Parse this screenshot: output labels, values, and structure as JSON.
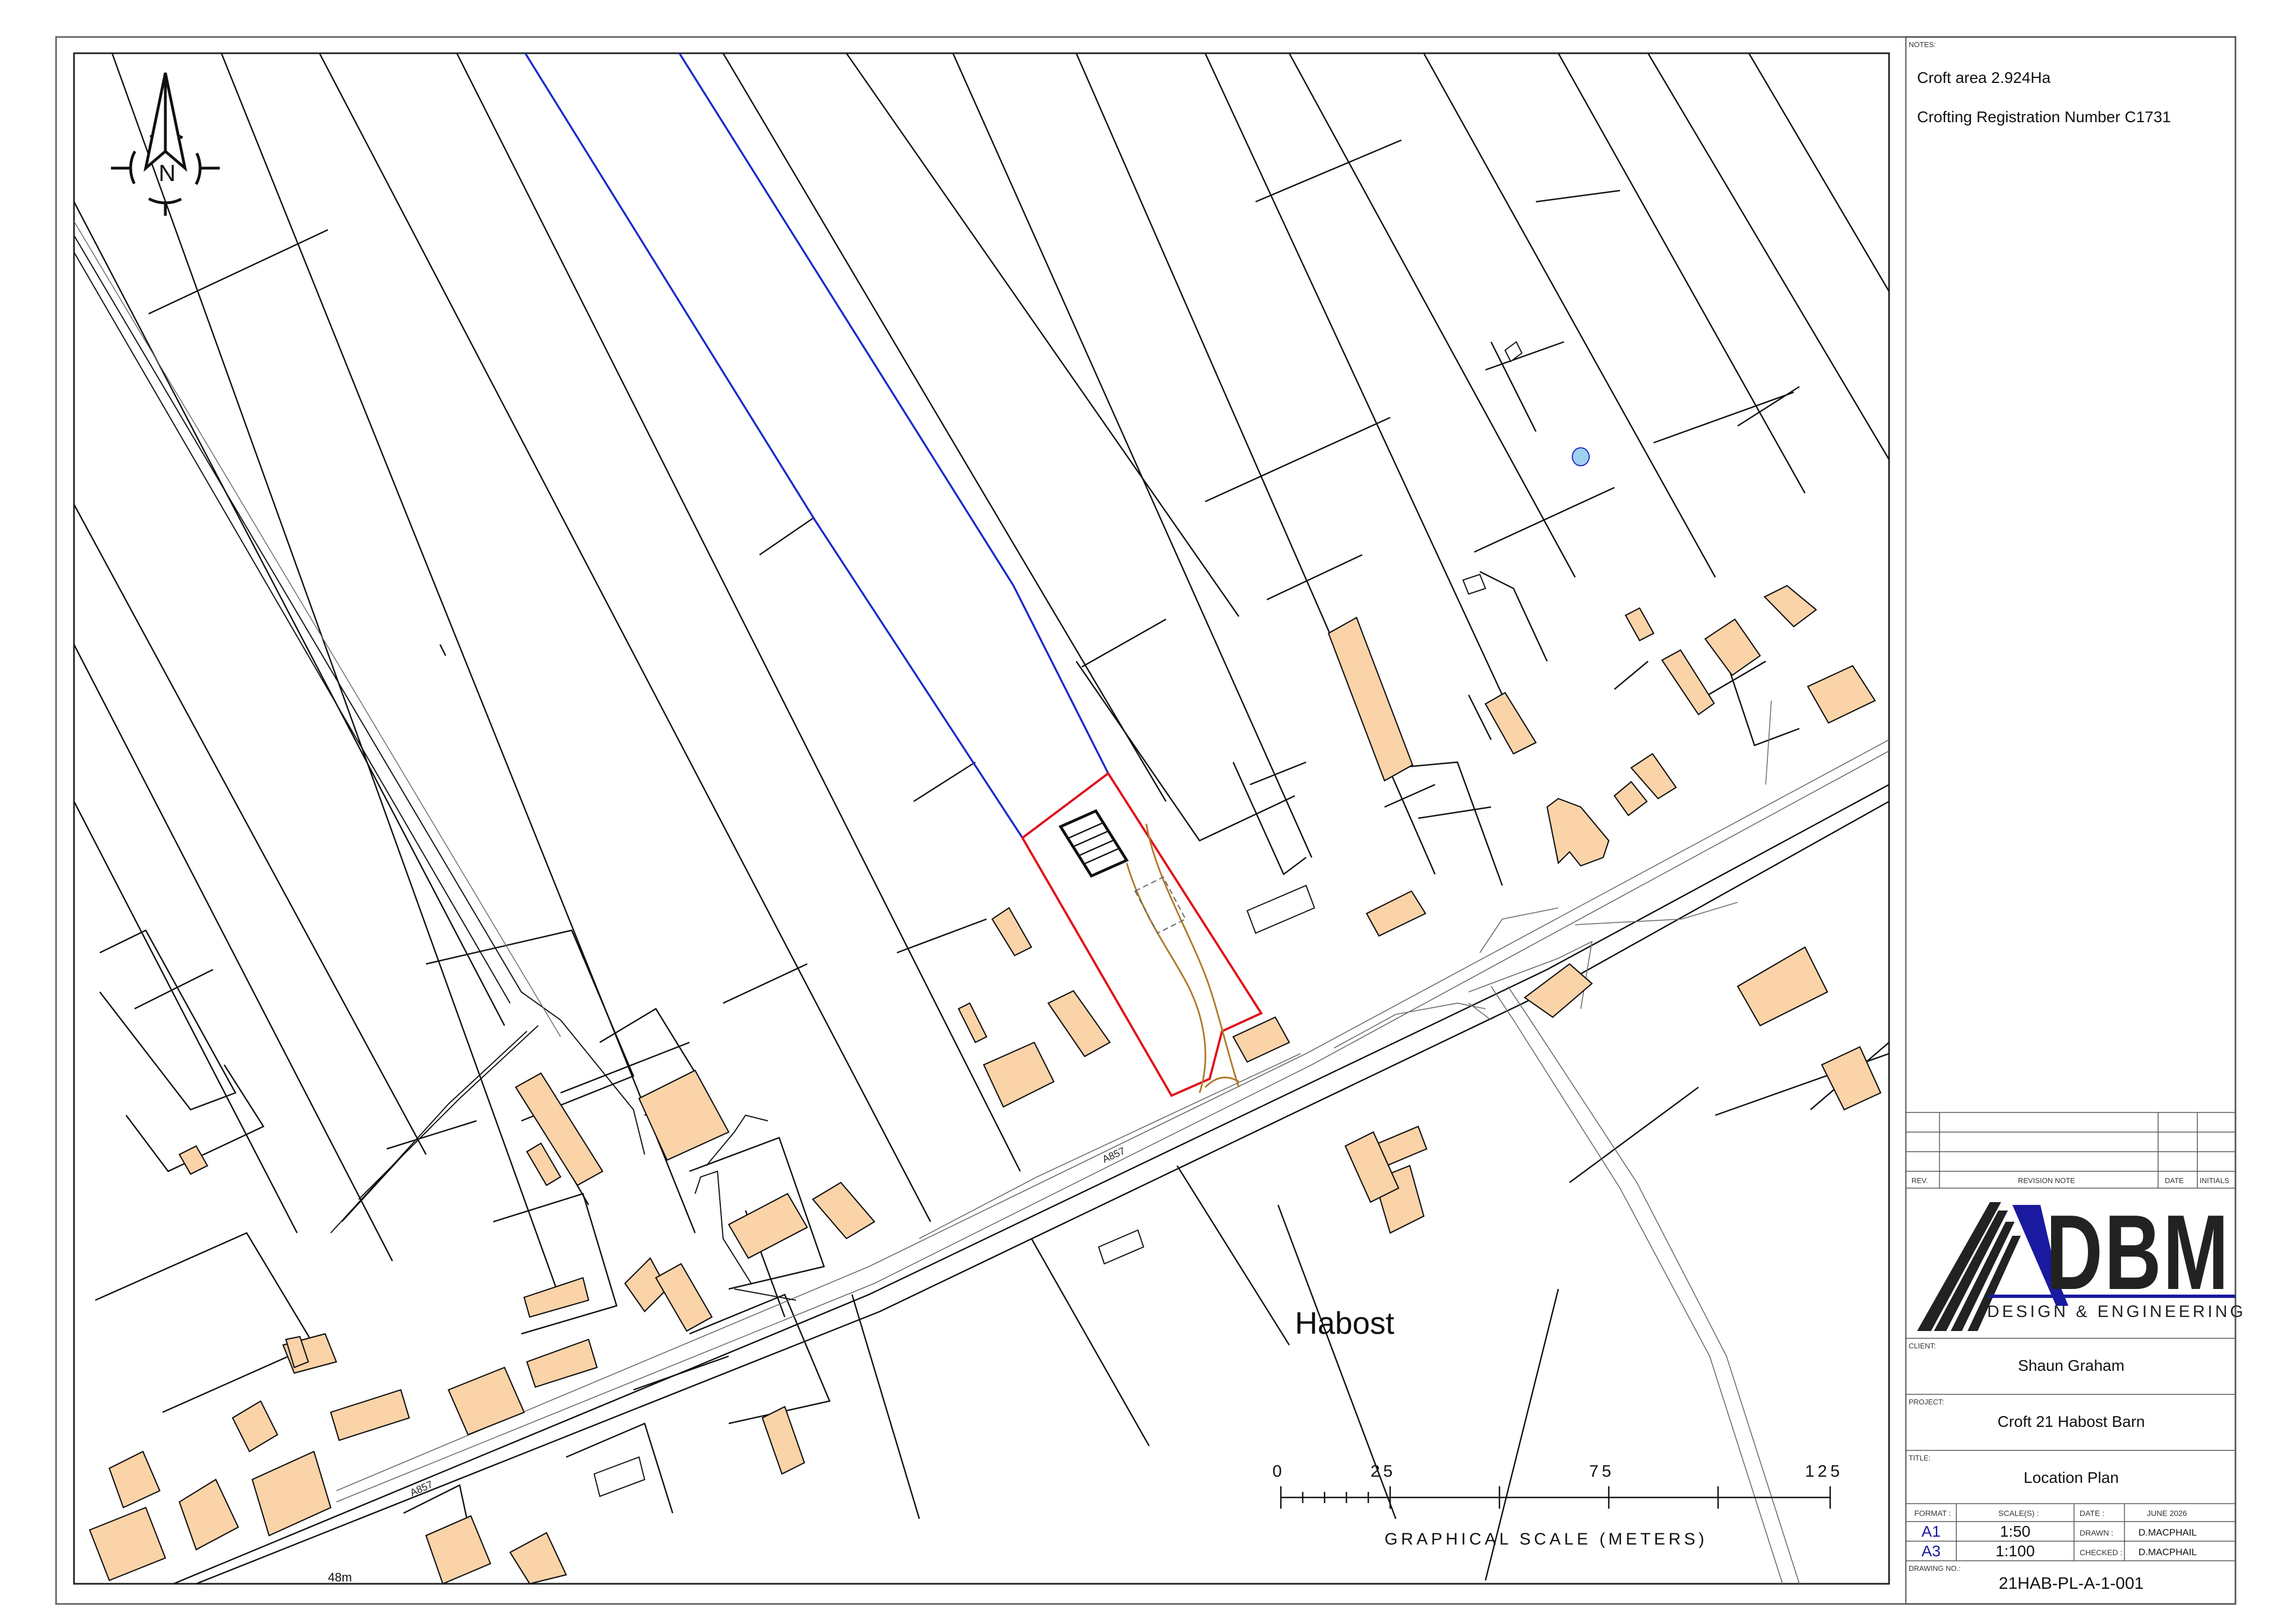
{
  "map": {
    "place_label": "Habost",
    "road_labels": [
      "A857",
      "A857"
    ],
    "spot_height": "48m",
    "north_letter": "N",
    "scale_bar": {
      "ticks": [
        "0",
        "25",
        "75",
        "125"
      ],
      "caption": "GRAPHICAL SCALE (METERS)"
    },
    "colors": {
      "building_fill": "#fbd3a8",
      "site_boundary": "#e0121a",
      "croft_boundary": "#1b2bc8",
      "track": "#b07a2a",
      "water": "#9fd0f0"
    }
  },
  "notes": {
    "heading": "NOTES:",
    "lines": [
      "Croft area 2.924Ha",
      "Crofting Registration Number C1731"
    ]
  },
  "revision": {
    "headers": {
      "rev": "REV.",
      "note": "REVISION NOTE",
      "date": "DATE",
      "initials": "INITIALS"
    }
  },
  "logo": {
    "letters": "DBM",
    "tagline": "DESIGN & ENGINEERING"
  },
  "client": {
    "label": "CLIENT:",
    "value": "Shaun Graham"
  },
  "project": {
    "label": "PROJECT:",
    "value": "Croft 21 Habost Barn"
  },
  "title": {
    "label": "TITLE:",
    "value": "Location Plan"
  },
  "format_table": {
    "format_label": "FORMAT :",
    "scale_label": "SCALE(S) :",
    "date_label": "DATE :",
    "date_value": "JUNE 2026",
    "drawn_label": "DRAWN :",
    "drawn_value": "D.MACPHAIL",
    "checked_label": "CHECKED :",
    "checked_value": "D.MACPHAIL",
    "rows": [
      {
        "format": "A1",
        "scale": "1:50"
      },
      {
        "format": "A3",
        "scale": "1:100"
      }
    ]
  },
  "drawing_no": {
    "label": "DRAWING NO.:",
    "value": "21HAB-PL-A-1-001"
  }
}
